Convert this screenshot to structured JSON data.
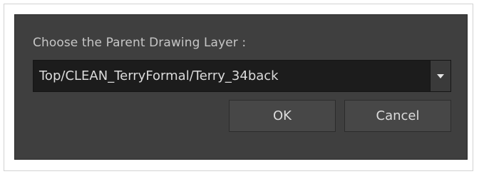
{
  "dialog": {
    "prompt": "Choose the Parent Drawing Layer :",
    "layer_select": {
      "selected_value": "Top/CLEAN_TerryFormal/Terry_34back",
      "arrow_icon": "chevron-down-icon"
    },
    "ok_label": "OK",
    "cancel_label": "Cancel"
  },
  "colors": {
    "dialog_background": "#3f3f3f",
    "field_background": "#1c1c1c",
    "button_background": "#474747",
    "text": "#dcdcdc"
  }
}
